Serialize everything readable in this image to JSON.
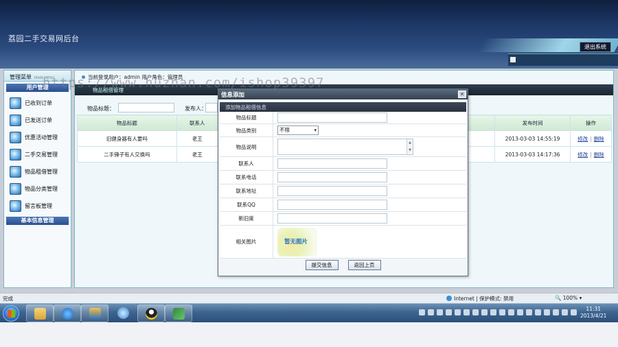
{
  "header": {
    "title": "荔园二手交易网后台",
    "logout": "退出系统"
  },
  "sidebar": {
    "title": "管理菜单",
    "title_en": "MAIN MENU",
    "group1": "用户管理",
    "items": [
      {
        "label": "已收到订单"
      },
      {
        "label": "已发送订单"
      },
      {
        "label": "优惠活动管理"
      },
      {
        "label": "二手交易管理"
      },
      {
        "label": "物品租借管理"
      },
      {
        "label": "物品分类管理"
      },
      {
        "label": "留言板管理"
      }
    ],
    "group2": "基本信息管理"
  },
  "main": {
    "userbar": "当前登录用户：admin  用户角色：管理员",
    "crumb": "物品租借管理",
    "search": {
      "label_title": "物品标题：",
      "label_pub": "发布人："
    },
    "columns": [
      "物品标题",
      "联系人",
      "发布时间",
      "操作"
    ],
    "rows": [
      {
        "title": "旧健身器有人要吗",
        "contact": "老王",
        "time": "2013-03-03 14:55:19",
        "edit": "修改",
        "del": "删除"
      },
      {
        "title": "二手锤子有人交换吗",
        "contact": "老王",
        "time": "2013-03-03 14:17:36",
        "edit": "修改",
        "del": "删除"
      }
    ]
  },
  "dialog": {
    "title": "信息添加",
    "close": "✕",
    "subtitle": "添加物品租借信息",
    "fields": {
      "title": "物品标题",
      "category": "物品类别",
      "category_value": "不限",
      "desc": "物品说明",
      "contact": "联系人",
      "phone": "联系电话",
      "address": "联系地址",
      "qq": "联系QQ",
      "condition": "新旧度",
      "image": "相关图片",
      "image_placeholder": "暂无图片"
    },
    "submit": "提交信息",
    "back": "返回上页"
  },
  "watermark": "https://www.huzhan.com/ishop39397",
  "status": {
    "left": "完成",
    "zone": "Internet | 保护模式: 禁用",
    "zoom": "100%"
  },
  "clock": {
    "time": "11:31",
    "date": "2013/4/21"
  },
  "taskbar_apps": [
    "explorer-icon",
    "ie-icon",
    "people-icon",
    "app-icon",
    "qq-icon",
    "excel-icon"
  ]
}
